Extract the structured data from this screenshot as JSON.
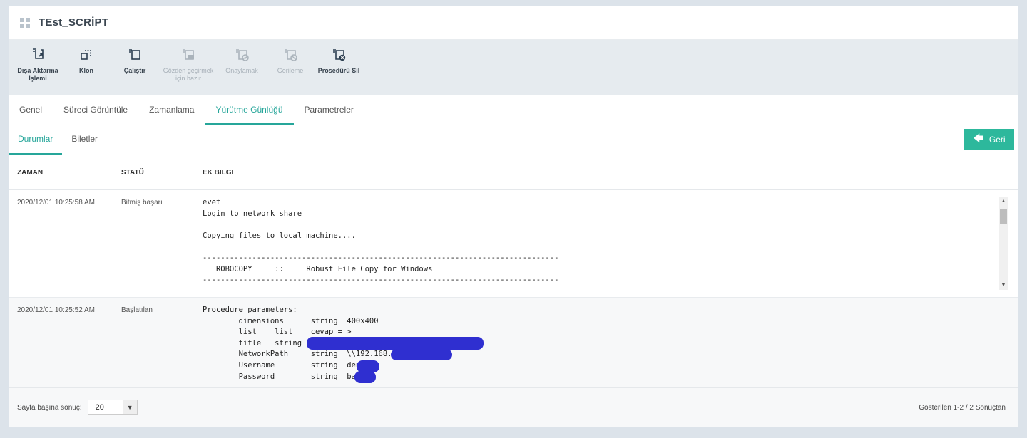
{
  "app": {
    "title": "TEst_SCRİPT"
  },
  "toolbar": [
    {
      "label": "Dışa Aktarma İşlemi",
      "icon": "export-icon",
      "enabled": true
    },
    {
      "label": "Klon",
      "icon": "clone-icon",
      "enabled": true
    },
    {
      "label": "Çalıştır",
      "icon": "run-icon",
      "enabled": true
    },
    {
      "label": "Gözden geçirmek için hazır",
      "icon": "review-icon",
      "enabled": false
    },
    {
      "label": "Onaylamak",
      "icon": "approve-icon",
      "enabled": false
    },
    {
      "label": "Gerileme",
      "icon": "revert-icon",
      "enabled": false
    },
    {
      "label": "Prosedürü Sil",
      "icon": "delete-procedure-icon",
      "enabled": true
    }
  ],
  "tabs": [
    {
      "label": "Genel"
    },
    {
      "label": "Süreci Görüntüle"
    },
    {
      "label": "Zamanlama"
    },
    {
      "label": "Yürütme Günlüğü",
      "active": true
    },
    {
      "label": "Parametreler"
    }
  ],
  "subtabs": [
    {
      "label": "Durumlar",
      "active": true
    },
    {
      "label": "Biletler"
    }
  ],
  "back_button": {
    "label": "Geri",
    "icon": "arrow-left-icon"
  },
  "table": {
    "headers": [
      "ZAMAN",
      "STATÜ",
      "EK BILGI"
    ],
    "rows": [
      {
        "time": "2020/12/01 10:25:58 AM",
        "status": "Bitmiş başarı",
        "info": "evet\nLogin to network share\n\nCopying files to local machine....\n\n-------------------------------------------------------------------------------\n   ROBOCOPY     ::     Robust File Copy for Windows\n-------------------------------------------------------------------------------"
      },
      {
        "time": "2020/12/01 10:25:52 AM",
        "status": "Başlatılan",
        "info": "Procedure parameters:\n        dimensions      string  400x400\n        list    list    cevap = >\n        title   string\n        NetworkPath     string  \\\\192.168.\n        Username        string  den\n        Password        string  ba"
      }
    ]
  },
  "footer": {
    "page_size_label": "Sayfa başına sonuç:",
    "page_size_value": "20",
    "summary": "Gösterilen 1-2 / 2 Sonuçtan"
  },
  "colors": {
    "accent": "#26a69a",
    "button": "#2db89c",
    "redaction": "#2f2fd0"
  }
}
